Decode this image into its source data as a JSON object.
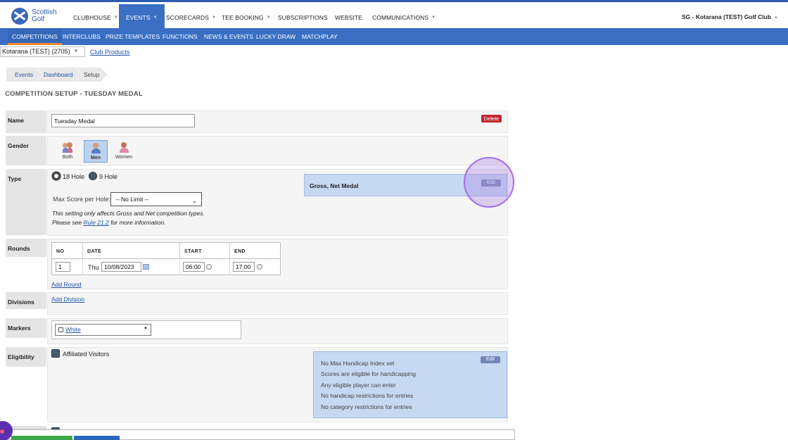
{
  "brand": {
    "line1": "Scottish",
    "line2": "Golf"
  },
  "topnav": {
    "items": [
      "CLUBHOUSE",
      "EVENTS",
      "SCORECARDS",
      "TEE BOOKING",
      "SUBSCRIPTIONS",
      "WEBSITE",
      "COMMUNICATIONS"
    ],
    "active": "EVENTS",
    "club": "SG - Kotarana (TEST) Golf Club"
  },
  "subnav": {
    "items": [
      "COMPETITIONS",
      "INTERCLUBS",
      "PRIZE TEMPLATES",
      "FUNCTIONS",
      "NEWS & EVENTS",
      "LUCKY DRAW",
      "MATCHPLAY"
    ],
    "active": "COMPETITIONS"
  },
  "club_select": {
    "value": "Kotarana (TEST) (2705)"
  },
  "club_products": "Club Products",
  "breadcrumb": [
    "Events",
    "Dashboard",
    "Setup"
  ],
  "page_title": "COMPETITION SETUP - TUESDAY MEDAL",
  "labels": {
    "name": "Name",
    "gender": "Gender",
    "type": "Type",
    "rounds": "Rounds",
    "divisions": "Divisions",
    "markers": "Markers",
    "eligibility": "Eligibility"
  },
  "name_value": "Tuesday Medal",
  "delete": "Delete",
  "gender": {
    "options": [
      "Both",
      "Men",
      "Women"
    ],
    "selected": "Men"
  },
  "type": {
    "holes": [
      "18 Hole",
      "9 Hole"
    ],
    "selected_holes": "18 Hole",
    "max_score_label": "Max Score per Hole:",
    "max_score_value": "-- No Limit --",
    "note_line1": "This setting only affects Gross and Net competition types.",
    "note_pre": "Please see",
    "note_link": "Rule 21.2",
    "note_post": "for more information.",
    "summary": "Gross, Net Medal",
    "edit": "Edit"
  },
  "rounds": {
    "headers": [
      "NO",
      "DATE",
      "START",
      "END"
    ],
    "rows": [
      {
        "no": "1",
        "day": "Thu",
        "date": "10/08/2023",
        "start": "06:00",
        "end": "17:00"
      }
    ],
    "add": "Add Round"
  },
  "divisions": {
    "add": "Add Division"
  },
  "markers": {
    "value": "White"
  },
  "eligibility": {
    "option": "Affiliated Visitors",
    "edit": "Edit",
    "summary": [
      "No Max Handicap Index set",
      "Scores are eligible for handicapping",
      "Any eligible player can enter",
      "No handicap restrictions for entries",
      "No category restrictions for entries"
    ]
  },
  "colors": {
    "primary": "#3a6fc4",
    "accent": "#f08a2a",
    "delete": "#c0262e",
    "panel": "#c7d8f2",
    "highlight": "#a46ee6"
  }
}
